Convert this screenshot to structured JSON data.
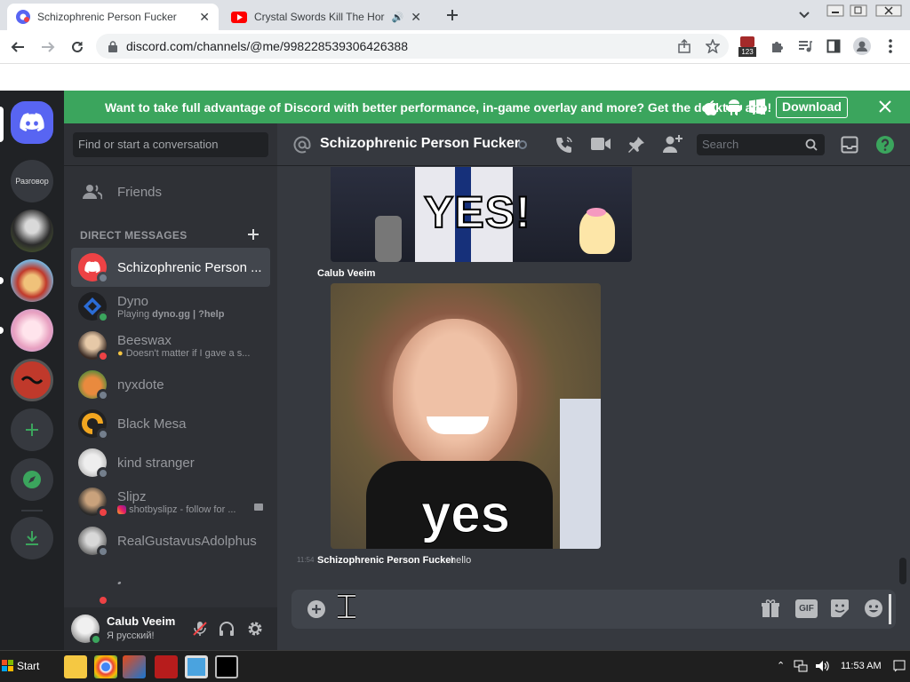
{
  "browser": {
    "tabs": [
      {
        "title": "Schizophrenic Person Fucker",
        "active": true
      },
      {
        "title": "Crystal Swords Kill The Horde",
        "active": false
      }
    ],
    "url": "discord.com/channels/@me/998228539306426388",
    "extension_badge": "123"
  },
  "banner": {
    "text": "Want to take full advantage of Discord with better performance, in-game overlay and more? Get the desktop app!",
    "download_label": "Download"
  },
  "guilds": {
    "server_label": "Разговор"
  },
  "dm_sidebar": {
    "search_placeholder": "Find or start a conversation",
    "friends_label": "Friends",
    "section_header": "DIRECT MESSAGES",
    "items": [
      {
        "name": "Schizophrenic Person ...",
        "subtitle": "",
        "status": "offline",
        "selected": true
      },
      {
        "name": "Dyno",
        "subtitle_prefix": "Playing ",
        "subtitle_bold": "dyno.gg | ?help",
        "status": "online"
      },
      {
        "name": "Beeswax",
        "subtitle": "Doesn't matter if I gave a s...",
        "status": "dnd"
      },
      {
        "name": "nyxdote",
        "subtitle": "",
        "status": "offline"
      },
      {
        "name": "Black Mesa",
        "subtitle": "",
        "status": "offline"
      },
      {
        "name": "kind stranger",
        "subtitle": "",
        "status": "offline"
      },
      {
        "name": "Slipz",
        "subtitle": "shotbyslipz - follow for ...",
        "status": "dnd"
      },
      {
        "name": "RealGustavusAdolphus",
        "subtitle": "",
        "status": "offline"
      },
      {
        "name": "𝅘",
        "subtitle": "",
        "status": "dnd"
      }
    ]
  },
  "user_panel": {
    "username": "Calub Veeim",
    "status_text": "Я русский!"
  },
  "chat": {
    "channel_name": "Schizophrenic Person Fucker",
    "search_placeholder": "Search",
    "gif1_caption": "YES!",
    "author_label": "Calub Veeim",
    "gif2_caption": "yes",
    "last_message": {
      "time": "11:54",
      "author": "Schizophrenic Person Fucker",
      "text": "hello"
    },
    "gif_button_label": "GIF"
  },
  "taskbar": {
    "start_label": "Start",
    "clock": "11:53 AM"
  },
  "colors": {
    "blurple": "#5865f2",
    "green": "#3ba55d",
    "dnd": "#ed4245",
    "offline": "#747f8d"
  }
}
